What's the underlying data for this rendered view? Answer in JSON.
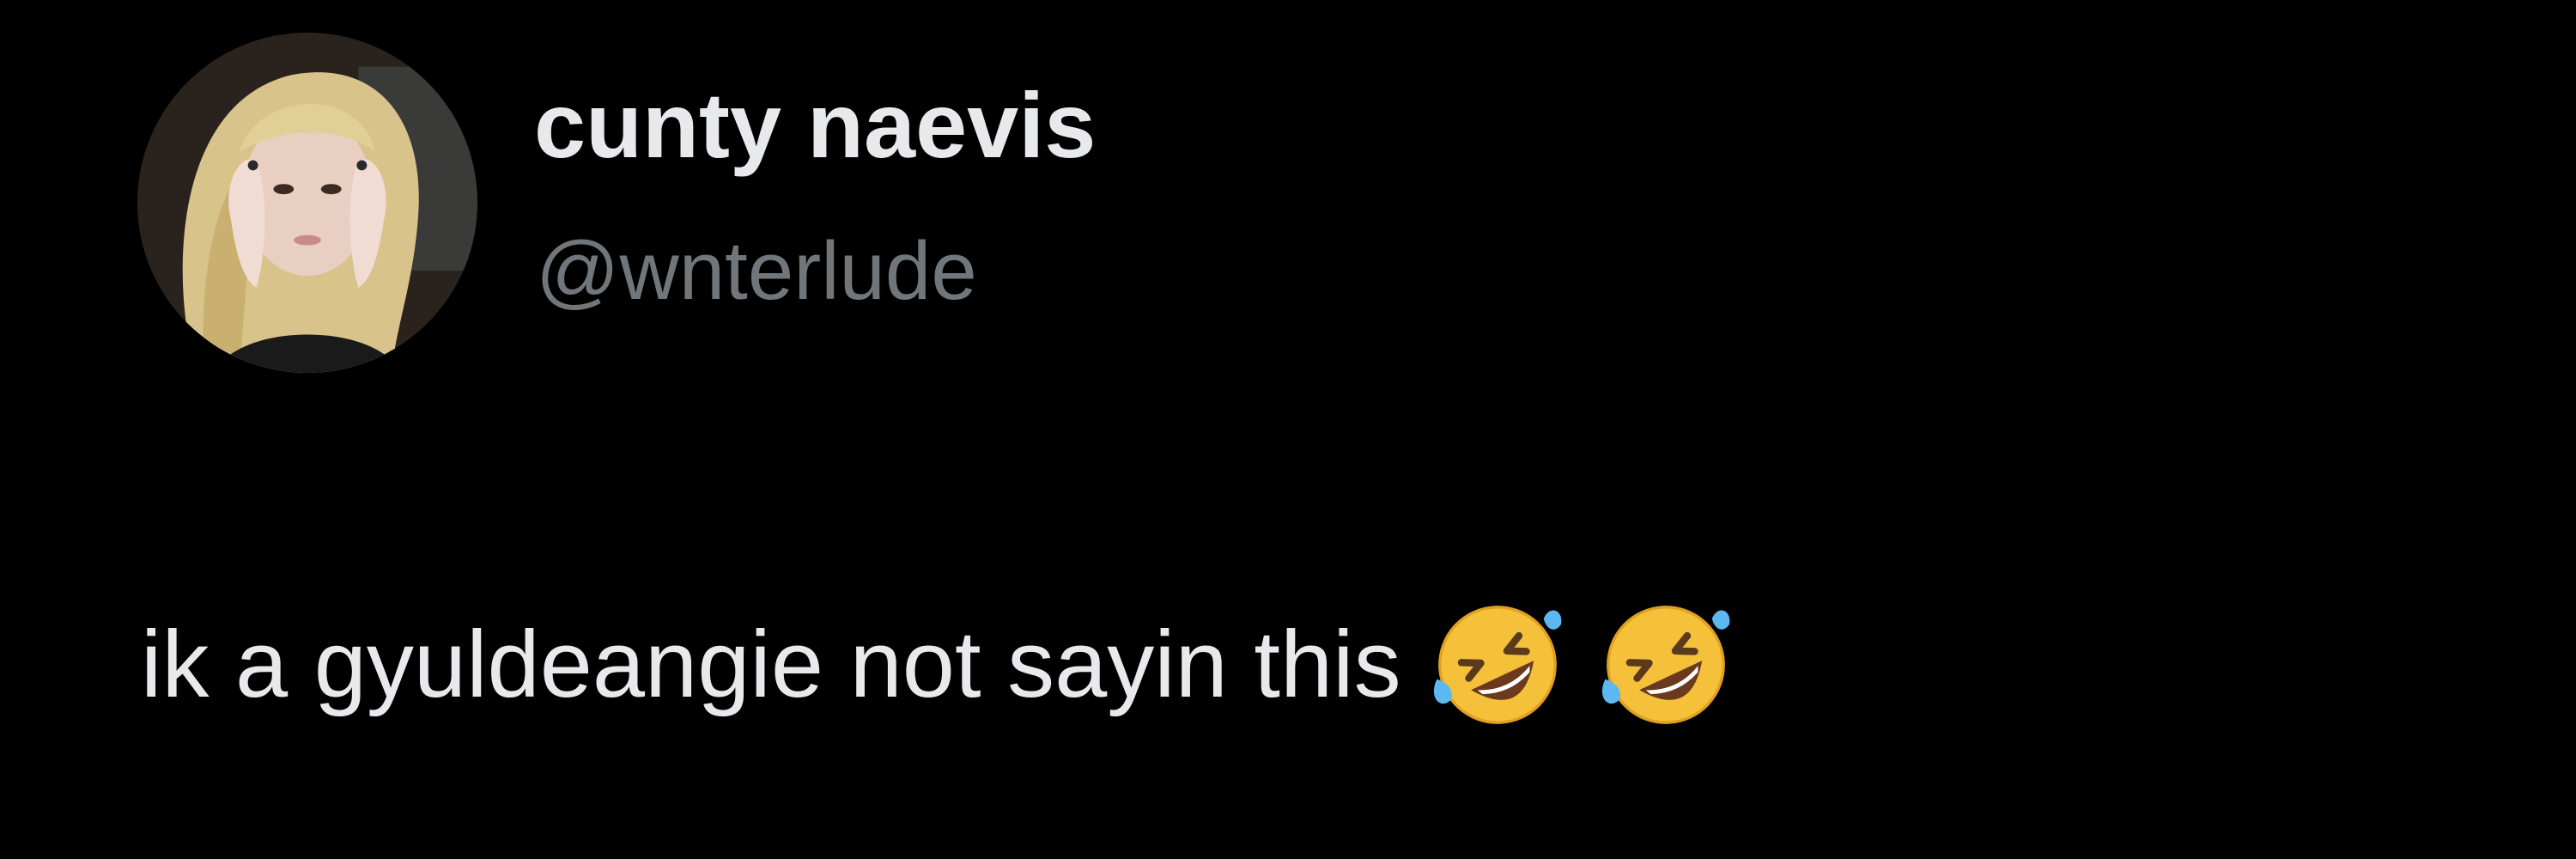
{
  "tweet": {
    "author": {
      "display_name": "cunty naevis",
      "handle": "@wnterlude",
      "avatar_icon": "profile-photo"
    },
    "text": "ik a gyuldeangie not sayin this",
    "emojis": [
      "rolling-on-the-floor-laughing-emoji",
      "rolling-on-the-floor-laughing-emoji"
    ]
  },
  "colors": {
    "background": "#000000",
    "primary_text": "#e7e9ea",
    "secondary_text": "#71767b",
    "emoji_yellow": "#f6c13a"
  }
}
